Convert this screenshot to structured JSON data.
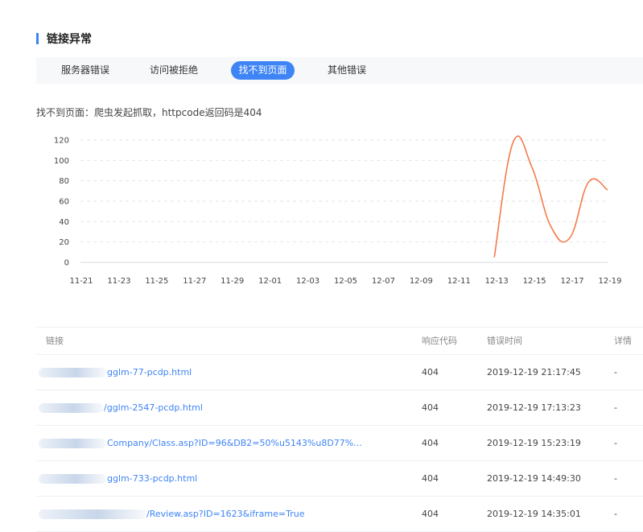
{
  "section": {
    "title": "链接异常"
  },
  "tabs": [
    {
      "label": "服务器错误"
    },
    {
      "label": "访问被拒绝"
    },
    {
      "label": "找不到页面"
    },
    {
      "label": "其他错误"
    }
  ],
  "description": "找不到页面：爬虫发起抓取，httpcode返回码是404",
  "colors": {
    "accent": "#3f84f5",
    "series": "#f47a4a"
  },
  "chart_data": {
    "type": "line",
    "x": [
      "11-21",
      "11-22",
      "11-23",
      "11-24",
      "11-25",
      "11-26",
      "11-27",
      "11-28",
      "11-29",
      "11-30",
      "12-01",
      "12-02",
      "12-03",
      "12-04",
      "12-05",
      "12-06",
      "12-07",
      "12-08",
      "12-09",
      "12-10",
      "12-11",
      "12-12",
      "12-13",
      "12-14",
      "12-15",
      "12-16",
      "12-17",
      "12-18",
      "12-19"
    ],
    "x_tick_labels": [
      "11-21",
      "11-23",
      "11-25",
      "11-27",
      "11-29",
      "12-01",
      "12-03",
      "12-05",
      "12-07",
      "12-09",
      "12-11",
      "12-13",
      "12-15",
      "12-17",
      "12-19"
    ],
    "series": [
      {
        "points": [
          {
            "x": "12-13",
            "y": 5
          },
          {
            "x": "12-14",
            "y": 118
          },
          {
            "x": "12-15",
            "y": 93
          },
          {
            "x": "12-16",
            "y": 35
          },
          {
            "x": "12-17",
            "y": 24
          },
          {
            "x": "12-18",
            "y": 79
          },
          {
            "x": "12-19",
            "y": 71
          }
        ]
      }
    ],
    "yticks": [
      0,
      20,
      40,
      60,
      80,
      100,
      120
    ],
    "ylim": [
      0,
      120
    ],
    "grid": true,
    "xlabel": "",
    "ylabel": ""
  },
  "table": {
    "headers": {
      "link": "链接",
      "code": "响应代码",
      "time": "错误时间",
      "detail": "详情"
    },
    "rows": [
      {
        "url": "gglm-77-pcdp.html",
        "code": "404",
        "time": "2019-12-19 21:17:45",
        "detail": "-"
      },
      {
        "url": "/gglm-2547-pcdp.html",
        "code": "404",
        "time": "2019-12-19 17:13:23",
        "detail": "-"
      },
      {
        "url": "Company/Class.asp?ID=96&DB2=50%u5143%u8D77%...",
        "code": "404",
        "time": "2019-12-19 15:23:19",
        "detail": "-"
      },
      {
        "url": "gglm-733-pcdp.html",
        "code": "404",
        "time": "2019-12-19 14:49:30",
        "detail": "-"
      },
      {
        "url": "/Review.asp?ID=1623&iframe=True",
        "code": "404",
        "time": "2019-12-19 14:35:01",
        "detail": "-"
      }
    ]
  }
}
